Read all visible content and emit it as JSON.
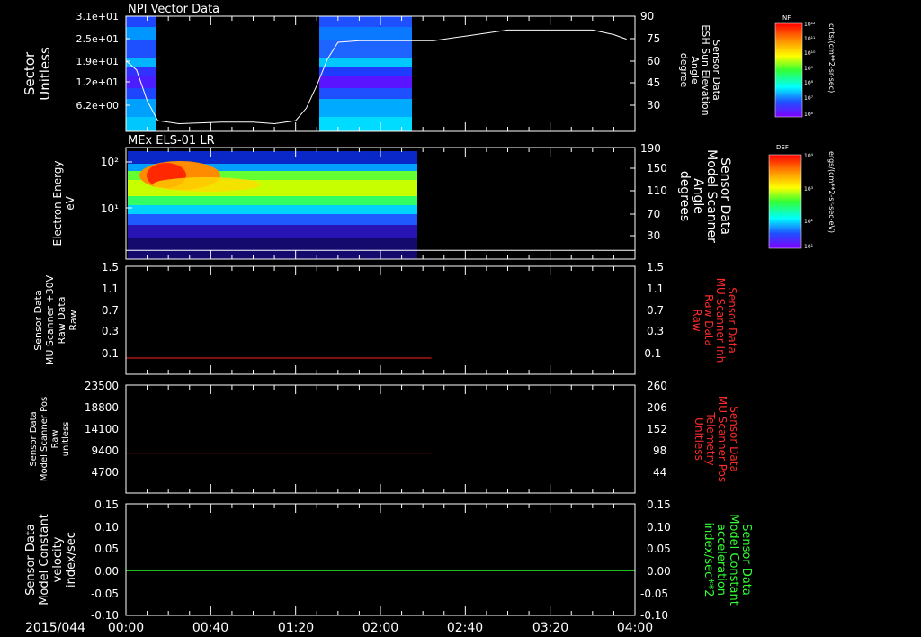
{
  "time_axis": {
    "date_label": "2015/044",
    "ticks": [
      "00:00",
      "00:40",
      "01:20",
      "02:00",
      "02:40",
      "03:20",
      "04:00"
    ]
  },
  "colorbars": [
    {
      "title": "NF",
      "unit": "cnts/(cm**2-sr-sec)",
      "tick_labels": [
        "10¹²",
        "10¹¹",
        "10¹⁰",
        "10⁹",
        "10⁸",
        "10⁷",
        "10⁶"
      ]
    },
    {
      "title": "DEF",
      "unit": "ergs/(cm**2-sr-sec-eV)",
      "tick_labels": [
        "10⁴",
        "10³",
        "10²",
        "10¹"
      ]
    }
  ],
  "chart_data": [
    {
      "type": "heatmap",
      "title": "NPI Vector Data",
      "ylabel": "Sector Unitless",
      "y_ticks": [
        "3.1e+01",
        "2.5e+01",
        "1.9e+01",
        "1.2e+01",
        "6.2e+00"
      ],
      "y2label": "Sensor Data ESH Sun Elevation Angle degree",
      "y2_ticks": [
        "90",
        "75",
        "60",
        "45",
        "30"
      ],
      "y2lim": [
        15,
        90
      ],
      "overlay_line": {
        "x_minutes": [
          0,
          5,
          10,
          15,
          25,
          45,
          60,
          70,
          80,
          85,
          90,
          95,
          100,
          110,
          130,
          145,
          160,
          180,
          200,
          220,
          230,
          236
        ],
        "y_values": [
          61,
          55,
          35,
          22,
          20,
          21,
          21,
          20,
          22,
          30,
          45,
          62,
          73,
          74,
          74,
          74,
          77,
          81,
          81,
          81,
          78,
          75
        ]
      }
    },
    {
      "type": "heatmap",
      "title": "MEx ELS-01 LR",
      "ylabel": "Electron Energy eV",
      "y_ticks": [
        "10²",
        "10¹"
      ],
      "y2label": "Sensor Data Model Scanner Angle degrees",
      "y2_ticks": [
        "190",
        "150",
        "110",
        "70",
        "30"
      ],
      "y2lim": [
        0,
        190
      ],
      "overlay_line": {
        "x_minutes": [
          0,
          240
        ],
        "y_values": [
          15,
          15
        ]
      }
    },
    {
      "type": "line",
      "ylabel": "Sensor Data MU Scanner +30V Raw Data Raw",
      "y_ticks": [
        "1.5",
        "1.1",
        "0.7",
        "0.3",
        "-0.1"
      ],
      "ylim": [
        -0.3,
        1.5
      ],
      "y2label": "Sensor Data MU Scanner Inh Raw Data Raw",
      "y2_ticks": [
        "1.5",
        "1.1",
        "0.7",
        "0.3",
        "-0.1"
      ],
      "series": [
        {
          "color": "#ff2020",
          "x_minutes": [
            0,
            144
          ],
          "y_values": [
            -0.03,
            -0.03
          ]
        }
      ]
    },
    {
      "type": "line",
      "ylabel": "Sensor Data Model Scanner Pos Raw unitless",
      "y_ticks": [
        "23500",
        "18800",
        "14100",
        "9400",
        "4700"
      ],
      "ylim": [
        0,
        23500
      ],
      "y2label": "Sensor Data MU Scanner Pos Telemetry Unitless",
      "y2_ticks": [
        "260",
        "206",
        "152",
        "98",
        "44"
      ],
      "series": [
        {
          "color": "#ff2020",
          "x_minutes": [
            0,
            144
          ],
          "y_values": [
            8700,
            8700
          ]
        }
      ]
    },
    {
      "type": "line",
      "ylabel": "Sensor Data Model Constant velocity index/sec",
      "y_ticks": [
        "0.15",
        "0.10",
        "0.05",
        "0.00",
        "-0.05",
        "-0.10"
      ],
      "ylim": [
        -0.1,
        0.15
      ],
      "y2label": "Sensor Data Model Constant acceleration index/sec**2",
      "y2_ticks": [
        "0.15",
        "0.10",
        "0.05",
        "0.00",
        "-0.05",
        "-0.10"
      ],
      "series": [
        {
          "color": "#22dd22",
          "x_minutes": [
            0,
            240
          ],
          "y_values": [
            0,
            0
          ]
        }
      ]
    }
  ]
}
